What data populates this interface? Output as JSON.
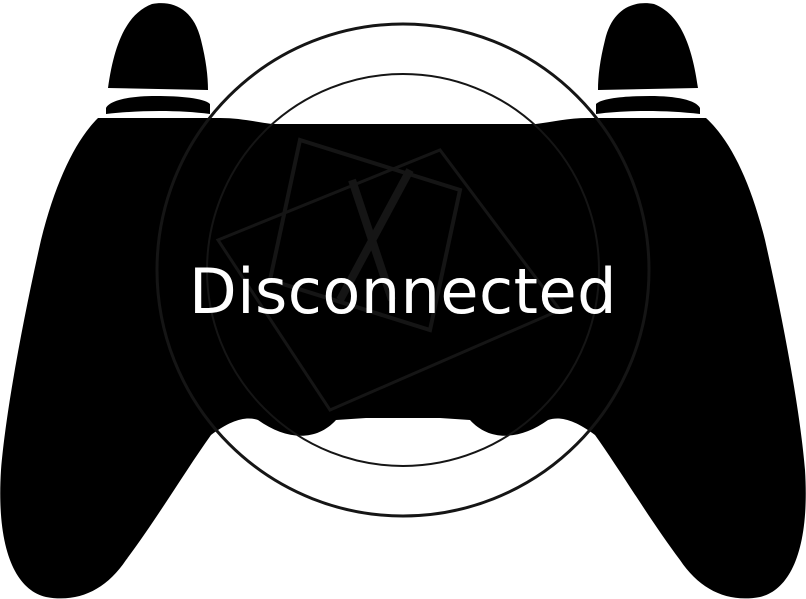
{
  "status": {
    "label": "Disconnected",
    "state": "disconnected",
    "text_color": "#ffffff"
  },
  "controller": {
    "icon": "gamepad-icon",
    "fill_color": "#000000",
    "background_color": "#ffffff",
    "watermark": "xbox-logo-icon",
    "watermark_color": "#151515"
  }
}
